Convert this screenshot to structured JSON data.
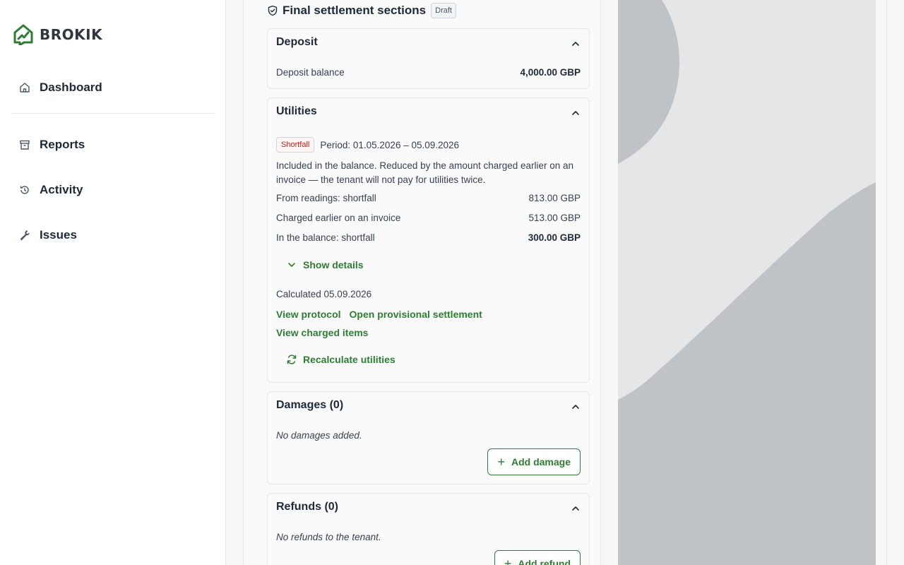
{
  "brand": {
    "name": "BROKIK"
  },
  "sidebar": {
    "items": [
      {
        "label": "Dashboard",
        "icon": "home-icon"
      },
      {
        "label": "Reports",
        "icon": "archive-icon"
      },
      {
        "label": "Activity",
        "icon": "history-icon"
      },
      {
        "label": "Issues",
        "icon": "wrench-icon"
      }
    ]
  },
  "panel": {
    "title": "Final settlement sections",
    "status_badge": "Draft",
    "deposit": {
      "title": "Deposit",
      "balance_label": "Deposit balance",
      "balance_value": "4,000.00 GBP"
    },
    "utilities": {
      "title": "Utilities",
      "badge": "Shortfall",
      "period": "Period: 01.05.2026 – 05.09.2026",
      "description": "Included in the balance. Reduced by the amount charged earlier on an invoice — the tenant will not pay for utilities twice.",
      "rows": [
        {
          "label": "From readings: shortfall",
          "value": "813.00 GBP"
        },
        {
          "label": "Charged earlier on an invoice",
          "value": "513.00 GBP"
        },
        {
          "label": "In the balance: shortfall",
          "value": "300.00 GBP"
        }
      ],
      "show_details": "Show details",
      "calculated": "Calculated 05.09.2026",
      "link_protocol": "View protocol",
      "link_provisional": "Open provisional settlement",
      "link_charged": "View charged items",
      "recalculate": "Recalculate utilities"
    },
    "damages": {
      "title": "Damages (0)",
      "empty": "No damages added.",
      "add_button": "Add damage"
    },
    "refunds": {
      "title": "Refunds (0)",
      "empty": "No refunds to the tenant.",
      "add_button": "Add refund"
    }
  },
  "colors": {
    "accent_green": "#2e7d32",
    "shortfall_red": "#b42318",
    "decor_gray": "#bfc3c6",
    "decor_light": "#e4e6e7"
  }
}
